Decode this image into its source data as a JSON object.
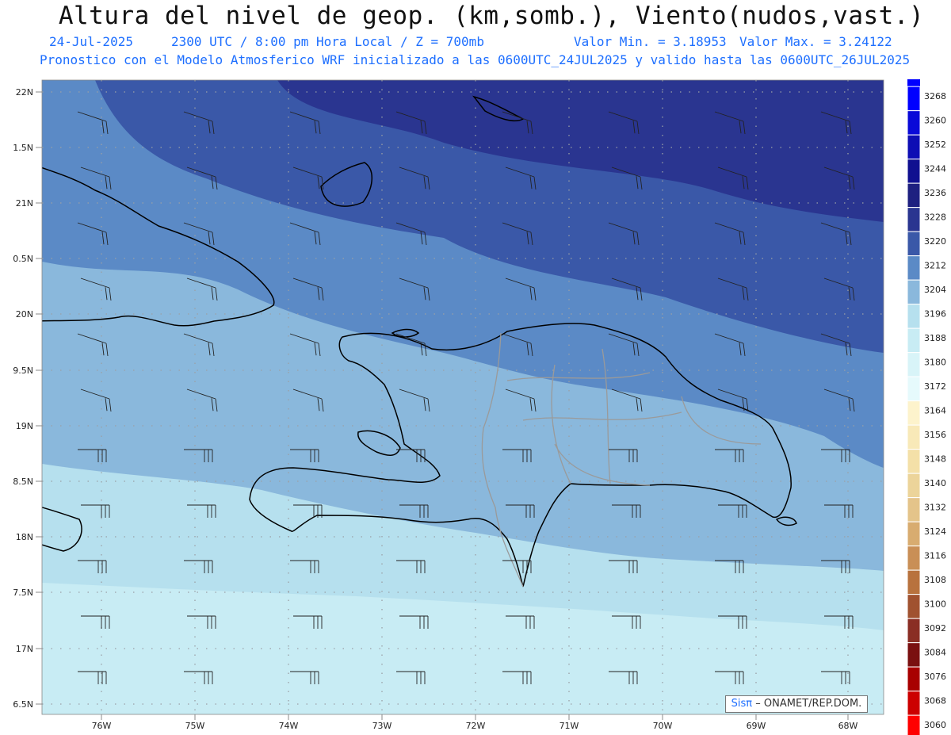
{
  "header": {
    "title": "Altura del nivel de geop. (km,somb.), Viento(nudos,vast.)",
    "date": "24-Jul-2025",
    "time_info": "2300 UTC / 8:00 pm Hora Local / Z = 700mb",
    "min_value": "Valor Min. = 3.18953",
    "max_value": "Valor Max. = 3.24122",
    "model_info": "Pronostico con el Modelo Atmosferico WRF inicializado a las 0600UTC_24JUL2025 y valido hasta las  0600UTC_26JUL2025"
  },
  "axes": {
    "lat_labels": [
      "22N",
      "1.5N",
      "21N",
      "0.5N",
      "20N",
      "9.5N",
      "19N",
      "8.5N",
      "18N",
      "7.5N",
      "17N",
      "6.5N"
    ],
    "lon_labels": [
      "76W",
      "75W",
      "74W",
      "73W",
      "72W",
      "71W",
      "70W",
      "69W",
      "68W"
    ]
  },
  "colorbar": {
    "levels": [
      "3268",
      "3260",
      "3252",
      "3244",
      "3236",
      "3228",
      "3220",
      "3212",
      "3204",
      "3196",
      "3188",
      "3180",
      "3172",
      "3164",
      "3156",
      "3148",
      "3140",
      "3132",
      "3124",
      "3116",
      "3108",
      "3100",
      "3092",
      "3084",
      "3076",
      "3068",
      "3060"
    ],
    "colors": [
      "#0000ff",
      "#0a0ad8",
      "#0e0eb4",
      "#101090",
      "#1e2080",
      "#2a3590",
      "#3a58a8",
      "#5b8ac6",
      "#8ab8dc",
      "#b6e0ee",
      "#c8ecf4",
      "#d8f4f8",
      "#e6fafc",
      "#fdf3cc",
      "#f8e9b8",
      "#f4e0a8",
      "#ecd49a",
      "#e4c48a",
      "#d8ac70",
      "#c98f56",
      "#b8723e",
      "#a05230",
      "#8a2e24",
      "#7a1010",
      "#a80000",
      "#cc0000",
      "#ff0000"
    ],
    "top_color": "#0000ff"
  },
  "credit": {
    "sis": "Sisπ",
    "text": "– ONAMET/REP.DOM."
  }
}
